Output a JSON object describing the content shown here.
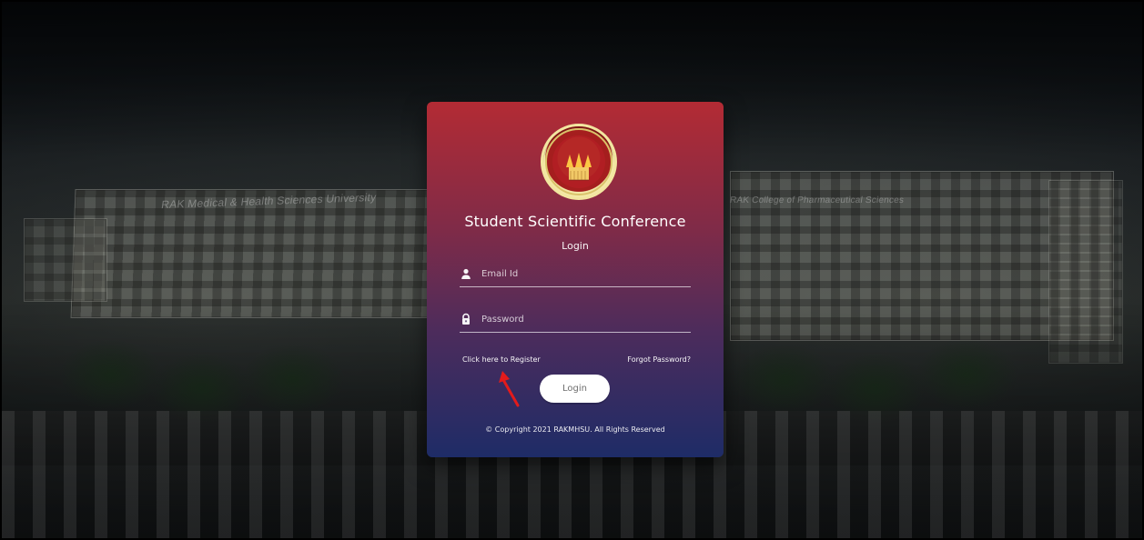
{
  "card": {
    "title": "Student Scientific Conference",
    "subtitle": "Login",
    "email": {
      "placeholder": "Email Id",
      "value": ""
    },
    "password": {
      "placeholder": "Password",
      "value": ""
    },
    "register_link": "Click here to Register",
    "forgot_link": "Forgot Password?",
    "login_button": "Login",
    "copyright": "© Copyright 2021 RAKMHSU. All Rights Reserved"
  },
  "background": {
    "left_building_label": "RAK Medical & Health Sciences University",
    "right_building_label": "RAK College of Pharmaceutical Sciences"
  },
  "icons": {
    "email": "user-icon",
    "password": "lock-icon"
  },
  "colors": {
    "card_top": "#b32b34",
    "card_bottom": "#1e2c67",
    "annotation_arrow": "#e31b1b"
  }
}
